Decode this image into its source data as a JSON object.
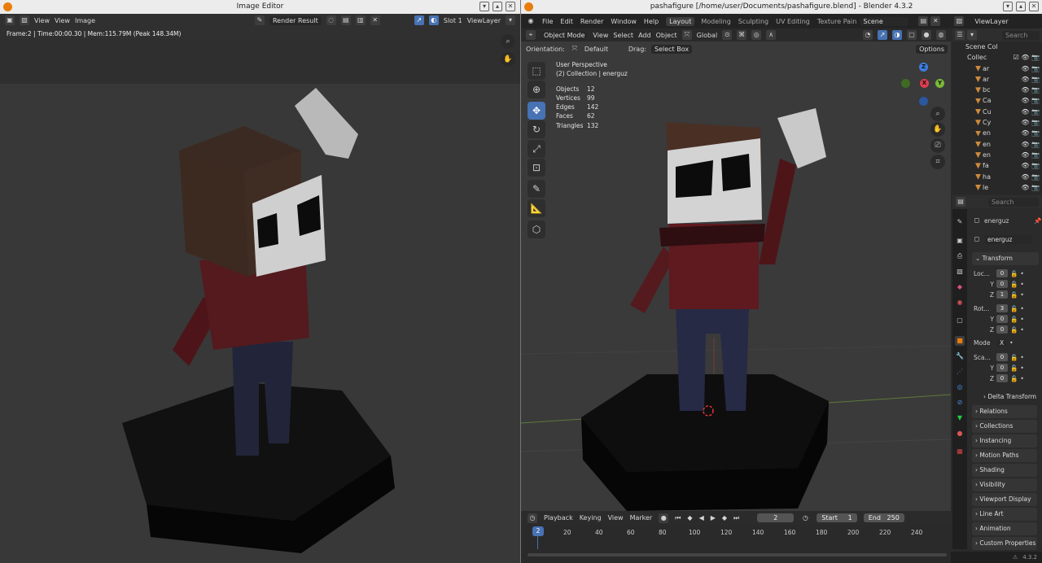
{
  "left_window": {
    "title": "Image Editor",
    "header": {
      "view_menu": "View",
      "menu_view": "View",
      "menu_image": "Image",
      "render_result": "Render Result",
      "slot": "Slot 1",
      "view_layer": "ViewLayer"
    },
    "info": "Frame:2 | Time:00:00.30 | Mem:115.79M (Peak 148.34M)"
  },
  "right_window": {
    "title": "pashafigure [/home/user/Documents/pashafigure.blend] - Blender 4.3.2",
    "menus": [
      "File",
      "Edit",
      "Render",
      "Window",
      "Help"
    ],
    "workspaces": [
      "Layout",
      "Modeling",
      "Sculpting",
      "UV Editing",
      "Texture Pain"
    ],
    "active_workspace": "Layout",
    "scene": "Scene",
    "view_layer": "ViewLayer",
    "viewport_header": {
      "mode": "Object Mode",
      "view": "View",
      "select": "Select",
      "add": "Add",
      "object": "Object",
      "transform": "Global"
    },
    "tool_settings": {
      "orientation_label": "Orientation:",
      "orientation": "Default",
      "drag_label": "Drag:",
      "drag": "Select Box",
      "options": "Options"
    },
    "overlay": {
      "perspective": "User Perspective",
      "collection": "(2) Collection | energuz"
    },
    "stats": [
      {
        "label": "Objects",
        "value": "12"
      },
      {
        "label": "Vertices",
        "value": "99"
      },
      {
        "label": "Edges",
        "value": "142"
      },
      {
        "label": "Faces",
        "value": "62"
      },
      {
        "label": "Triangles",
        "value": "132"
      }
    ],
    "gizmo": {
      "z": "Z",
      "x": "X",
      "y": "Y"
    },
    "outliner": {
      "search": "Search",
      "scene_collection": "Scene Col",
      "collection": "Collec",
      "items": [
        "ar",
        "ar",
        "bc",
        "Ca",
        "Cu",
        "Cy",
        "en",
        "en",
        "en",
        "fa",
        "ha",
        "le"
      ]
    },
    "properties": {
      "search": "Search",
      "object_name": "energuz",
      "object_data": "energuz",
      "transform": "Transform",
      "location_label": "Loc...",
      "rotation_label": "Rot...",
      "scale_label": "Sca...",
      "axis_y": "Y",
      "axis_z": "Z",
      "loc": [
        "0",
        "0",
        "1"
      ],
      "rot": [
        "3",
        "0",
        "0"
      ],
      "scale": [
        "0",
        "0",
        "0"
      ],
      "mode_label": "Mode",
      "mode": "X",
      "delta_transform": "Delta Transform",
      "sections": [
        "Relations",
        "Collections",
        "Instancing",
        "Motion Paths",
        "Shading",
        "Visibility",
        "Viewport Display",
        "Line Art",
        "Animation",
        "Custom Properties"
      ]
    },
    "timeline": {
      "playback": "Playback",
      "keying": "Keying",
      "view": "View",
      "marker": "Marker",
      "current_frame": "2",
      "start_label": "Start",
      "start": "1",
      "end_label": "End",
      "end": "250",
      "ticks": [
        "20",
        "40",
        "60",
        "80",
        "100",
        "120",
        "140",
        "160",
        "180",
        "200",
        "220",
        "240"
      ]
    },
    "version": "4.3.2"
  },
  "colors": {
    "accent": "#4772b3",
    "shirt": "#5e1a1f",
    "hair": "#4a2f24",
    "pants": "#262a45",
    "base": "#0f0f0f"
  }
}
